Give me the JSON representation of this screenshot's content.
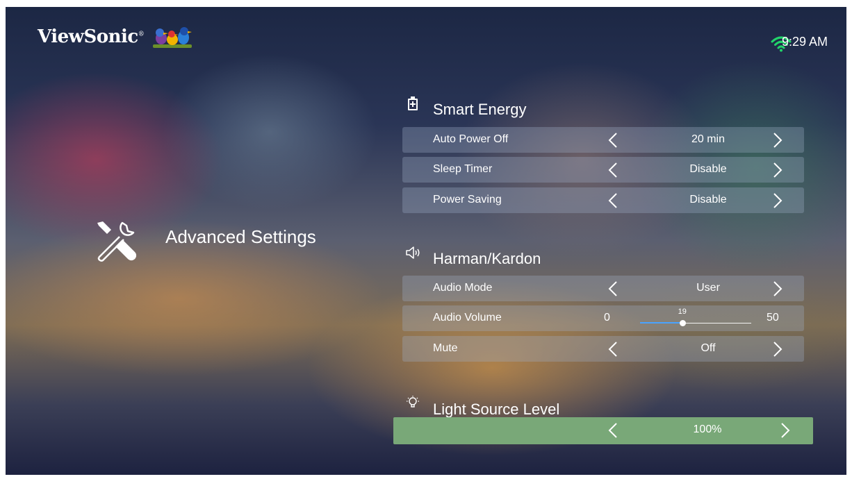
{
  "header": {
    "brand": "ViewSonic",
    "brand_mark": "®",
    "time": "9:29 AM",
    "wifi_icon": "wifi-icon",
    "mascot_icon": "viewsonic-birds-logo"
  },
  "page": {
    "title": "Advanced Settings",
    "icon": "tools-icon"
  },
  "sections": [
    {
      "title": "Smart Energy",
      "icon": "battery-icon",
      "rows": [
        {
          "label": "Auto Power Off",
          "value": "20 min"
        },
        {
          "label": "Sleep Timer",
          "value": "Disable"
        },
        {
          "label": "Power Saving",
          "value": "Disable"
        }
      ]
    },
    {
      "title": "Harman/Kardon",
      "icon": "speaker-icon",
      "rows": [
        {
          "label": "Audio Mode",
          "value": "User"
        },
        {
          "label": "Audio Volume",
          "min": "0",
          "max": "50",
          "value": "19"
        },
        {
          "label": "Mute",
          "value": "Off"
        }
      ]
    },
    {
      "title": "Light Source Level",
      "icon": "light-bulb-icon",
      "rows": [
        {
          "label": "",
          "value": "100%"
        }
      ]
    }
  ],
  "colors": {
    "highlight": "#79a878",
    "slider_fill": "#4aa3ff"
  }
}
